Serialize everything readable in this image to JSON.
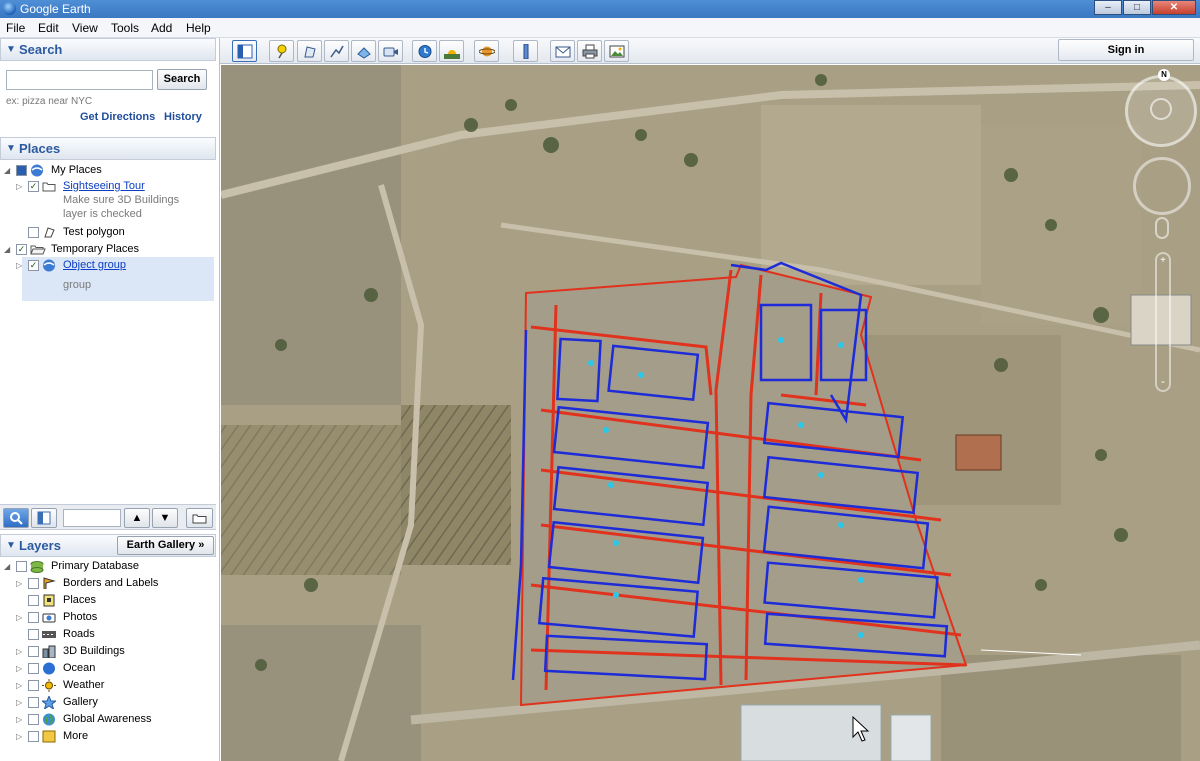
{
  "window": {
    "title": "Google Earth",
    "minimize": "–",
    "maximize": "□",
    "close": "✕"
  },
  "menu": [
    "File",
    "Edit",
    "View",
    "Tools",
    "Add",
    "Help"
  ],
  "search": {
    "header": "Search",
    "input_value": "",
    "button_label": "Search",
    "hint": "ex: pizza near NYC",
    "get_directions": "Get Directions",
    "history": "History"
  },
  "places": {
    "header": "Places",
    "items": [
      {
        "label": "My Places",
        "checked": true
      },
      {
        "label": "Sightseeing Tour",
        "checked": true,
        "description_line1": "Make sure 3D Buildings",
        "description_line2": "layer is checked"
      },
      {
        "label": "Test polygon",
        "checked": false
      },
      {
        "label": "Temporary Places",
        "checked": true
      },
      {
        "label": "Object group",
        "checked": true,
        "description": "group"
      }
    ]
  },
  "layers": {
    "header": "Layers",
    "gallery_button": "Earth Gallery »",
    "items": [
      {
        "label": "Primary Database",
        "icon": "database-icon"
      },
      {
        "label": "Borders and Labels",
        "icon": "borders-icon"
      },
      {
        "label": "Places",
        "icon": "places-icon"
      },
      {
        "label": "Photos",
        "icon": "photos-icon"
      },
      {
        "label": "Roads",
        "icon": "roads-icon"
      },
      {
        "label": "3D Buildings",
        "icon": "buildings-icon"
      },
      {
        "label": "Ocean",
        "icon": "ocean-icon"
      },
      {
        "label": "Weather",
        "icon": "weather-icon"
      },
      {
        "label": "Gallery",
        "icon": "gallery-icon"
      },
      {
        "label": "Global Awareness",
        "icon": "globe-icon"
      },
      {
        "label": "More",
        "icon": "more-icon"
      }
    ]
  },
  "toolbar": {
    "sign_in": "Sign in"
  },
  "compass": {
    "north": "N"
  },
  "colors": {
    "accent": "#2c5aa0",
    "parcel_outline": "#1d2bd8",
    "road_line": "#e0321c",
    "label_point": "#29c8e8"
  }
}
